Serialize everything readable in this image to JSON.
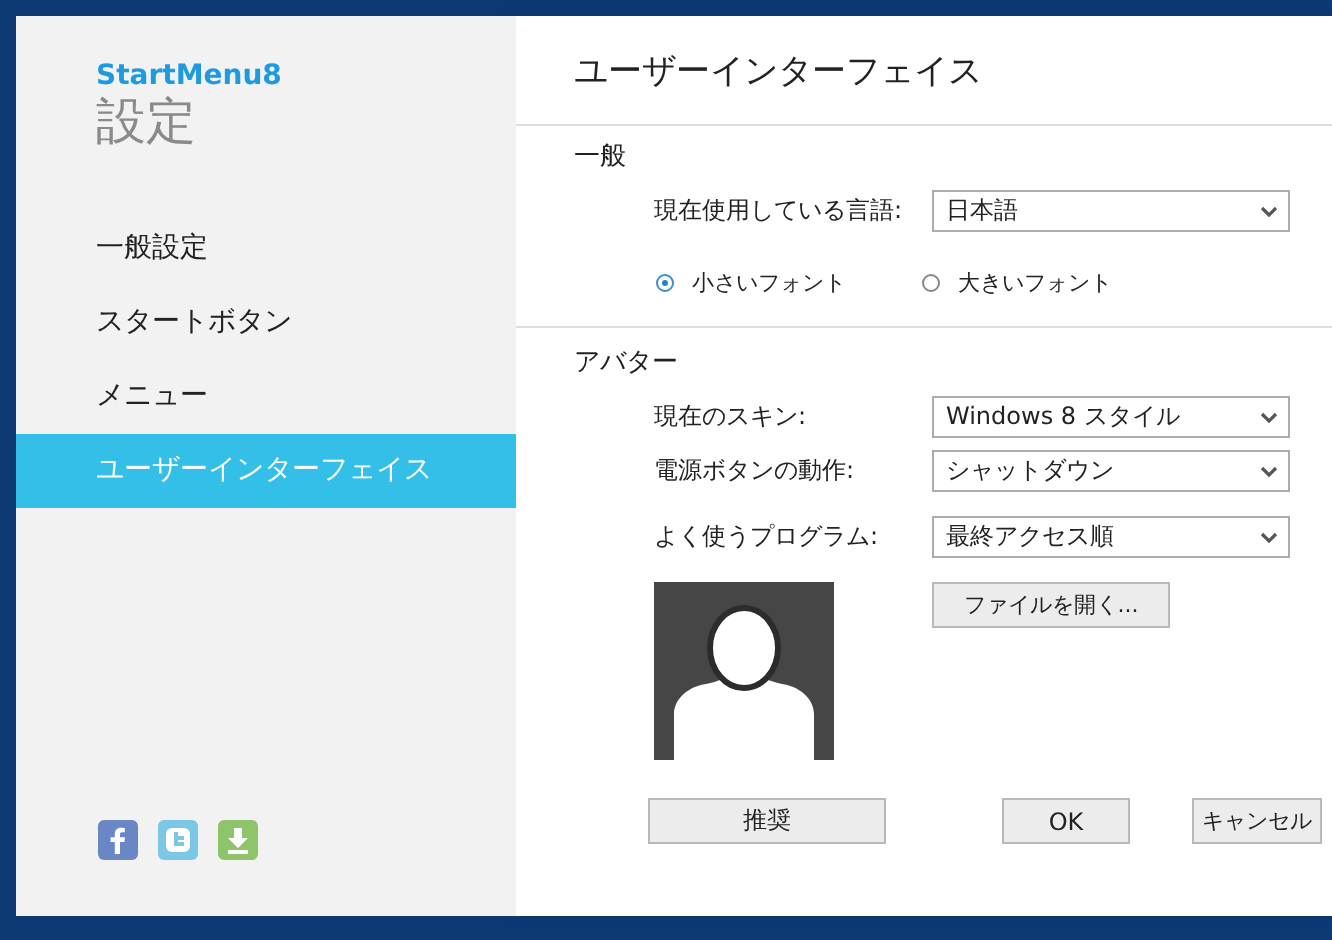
{
  "app": {
    "brand": "StartMenu8",
    "title": "設定"
  },
  "sidebar": {
    "items": [
      {
        "label": "一般設定",
        "selected": false
      },
      {
        "label": "スタートボタン",
        "selected": false
      },
      {
        "label": "メニュー",
        "selected": false
      },
      {
        "label": "ユーザーインターフェイス",
        "selected": true
      }
    ],
    "links": [
      {
        "kind": "facebook"
      },
      {
        "kind": "twitter"
      },
      {
        "kind": "download"
      }
    ]
  },
  "panel": {
    "title": "ユーザーインターフェイス",
    "general": {
      "heading": "一般",
      "language": {
        "label": "現在使用している言語:",
        "value": "日本語"
      },
      "font_size": [
        {
          "label": "小さいフォント",
          "selected": true
        },
        {
          "label": "大きいフォント",
          "selected": false
        }
      ]
    },
    "avatar": {
      "heading": "アバター",
      "fields": [
        {
          "label": "現在のスキン:",
          "value": "Windows 8 スタイル"
        },
        {
          "label": "電源ボタンの動作:",
          "value": "シャットダウン"
        },
        {
          "label": "よく使うプログラム:",
          "value": "最終アクセス順"
        }
      ],
      "open_button": "ファイルを開く..."
    },
    "buttons": [
      "推奨",
      "OK",
      "キャンセル"
    ]
  }
}
